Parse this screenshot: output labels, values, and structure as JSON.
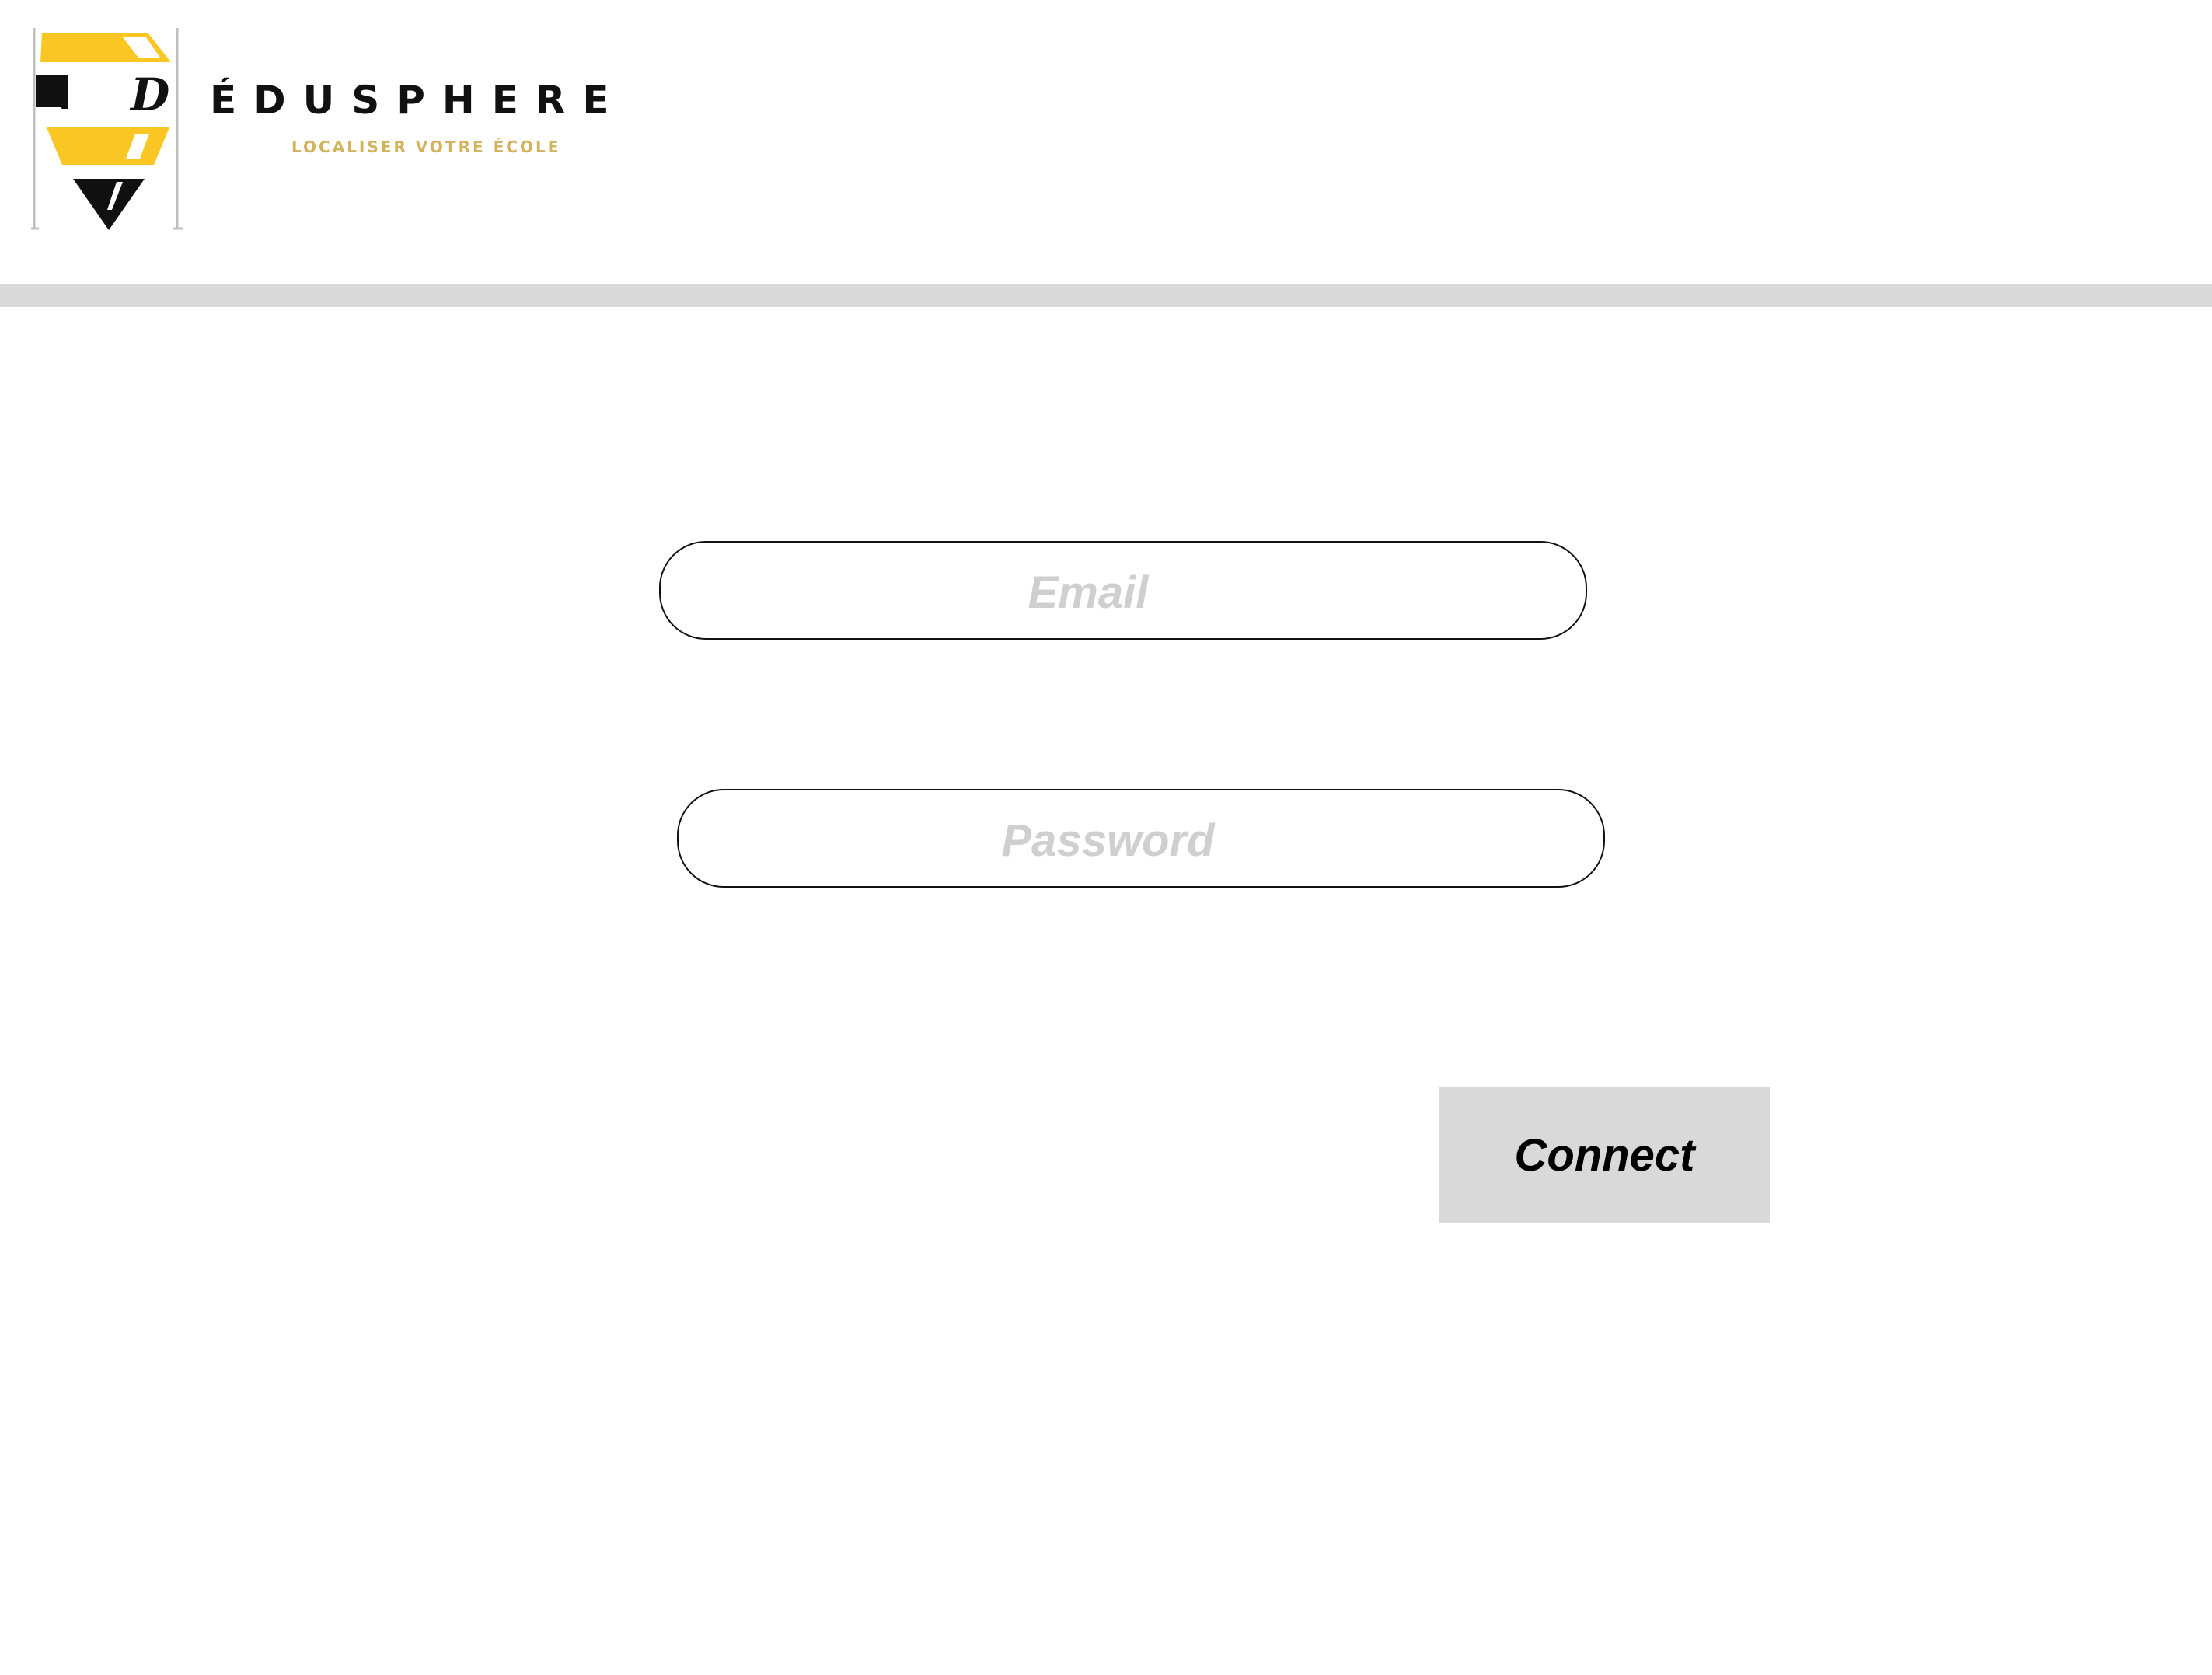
{
  "brand": {
    "name": "ÉDUSPHERE",
    "tagline": "LOCALISER VOTRE ÉCOLE",
    "logo_icon": "map-pin-logo-icon",
    "colors": {
      "yellow": "#F9C623",
      "black": "#111111",
      "tagline": "#D2B25B"
    }
  },
  "login_form": {
    "email": {
      "placeholder": "Email",
      "value": ""
    },
    "password": {
      "placeholder": "Password",
      "value": ""
    },
    "connect_label": "Connect"
  },
  "colors": {
    "divider": "#D9D9D9",
    "button_bg": "#D9D9D9",
    "placeholder": "#CFCFCF"
  }
}
